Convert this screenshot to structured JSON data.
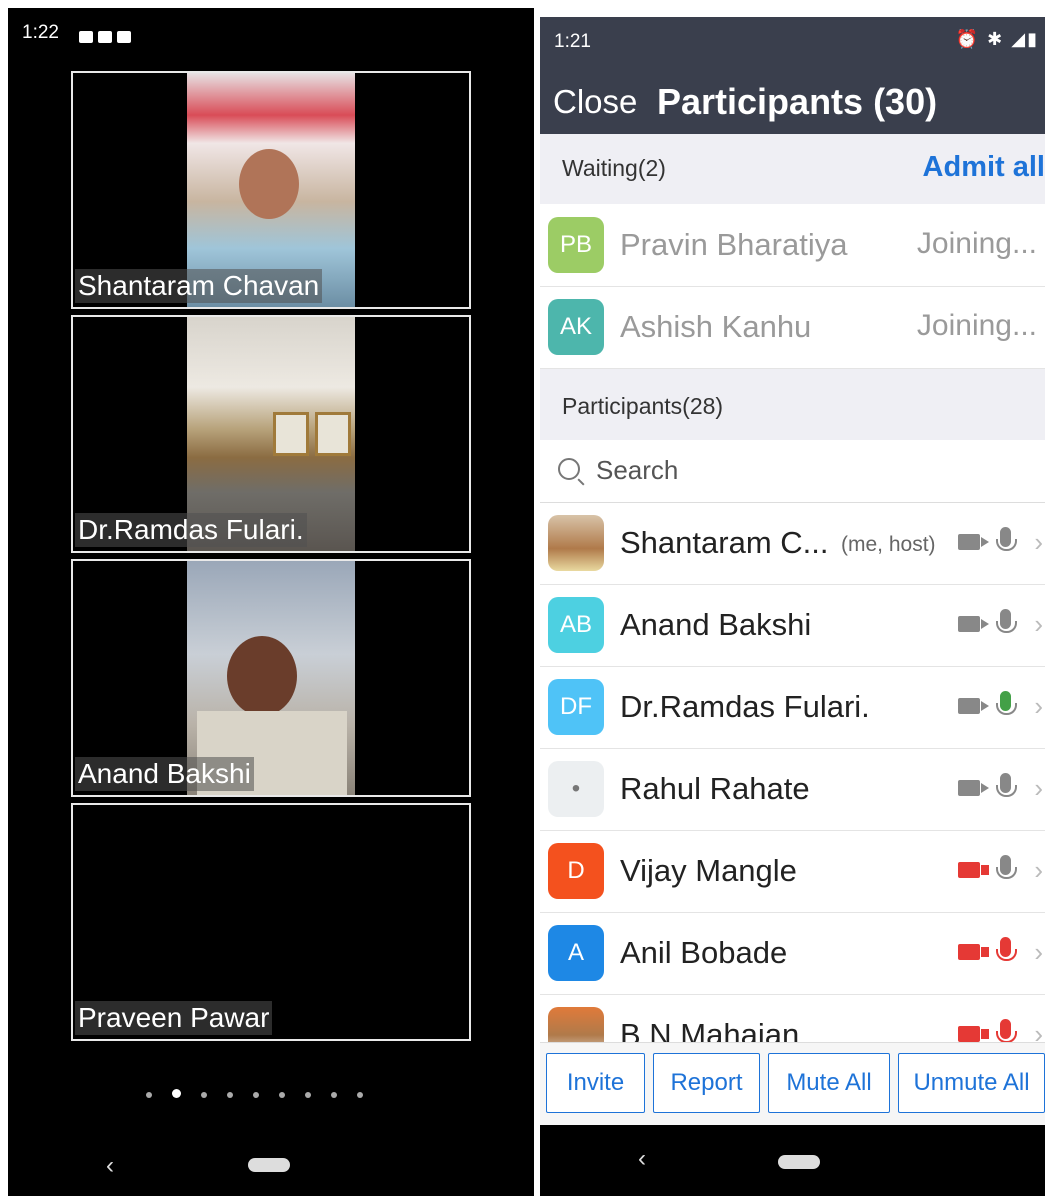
{
  "left_screen": {
    "status_time": "1:22",
    "tiles": [
      {
        "name": "Shantaram Chavan"
      },
      {
        "name": "Dr.Ramdas Fulari."
      },
      {
        "name": "Anand Bakshi"
      },
      {
        "name": "Praveen Pawar"
      }
    ],
    "page_dots": 9,
    "active_dot": 1
  },
  "right_screen": {
    "status_time": "1:21",
    "close_label": "Close",
    "title": "Participants (30)",
    "waiting_header": "Waiting(2)",
    "admit_all": "Admit all",
    "waiting": [
      {
        "initials": "PB",
        "name": "Pravin Bharatiya",
        "status": "Joining...",
        "color": "#9ccc65"
      },
      {
        "initials": "AK",
        "name": "Ashish Kanhu",
        "status": "Joining...",
        "color": "#4db6ac"
      }
    ],
    "participants_header": "Participants(28)",
    "search_placeholder": "Search",
    "participants": [
      {
        "initials": "",
        "name": "Shantaram C...",
        "tag": "(me, host)",
        "video": "on",
        "audio": "on",
        "color": "#c9a27e"
      },
      {
        "initials": "AB",
        "name": "Anand Bakshi",
        "tag": "",
        "video": "on",
        "audio": "on",
        "color": "#4dd0e1"
      },
      {
        "initials": "DF",
        "name": "Dr.Ramdas Fulari.",
        "tag": "",
        "video": "on",
        "audio": "speaking",
        "color": "#4fc3f7"
      },
      {
        "initials": "•",
        "name": "Rahul Rahate",
        "tag": "",
        "video": "on",
        "audio": "on",
        "color": "#eceff1"
      },
      {
        "initials": "D",
        "name": "Vijay Mangle",
        "tag": "",
        "video": "off",
        "audio": "on",
        "color": "#f4511e"
      },
      {
        "initials": "A",
        "name": "Anil Bobade",
        "tag": "",
        "video": "off",
        "audio": "off",
        "color": "#1e88e5"
      },
      {
        "initials": "",
        "name": "B N Mahajan",
        "tag": "",
        "video": "off",
        "audio": "off",
        "color": "#b07a4a"
      }
    ],
    "buttons": [
      "Invite",
      "Report",
      "Mute All",
      "Unmute All"
    ]
  }
}
